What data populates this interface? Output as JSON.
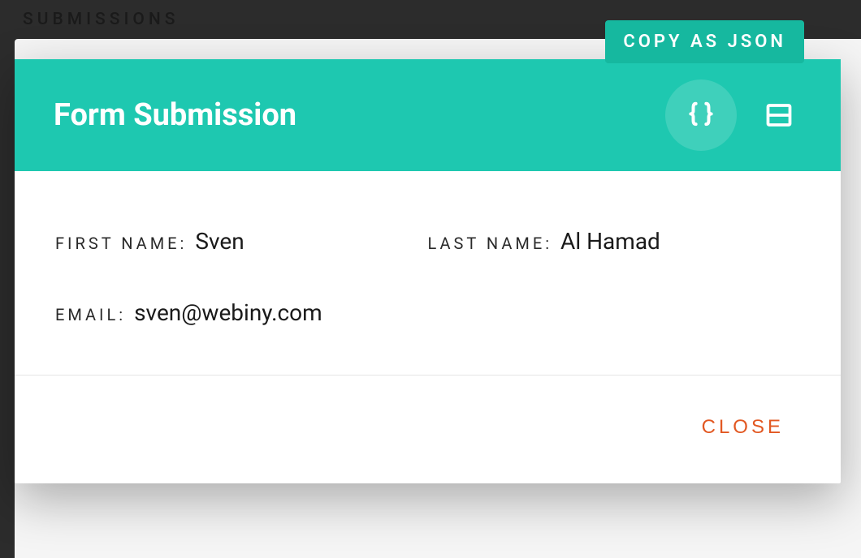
{
  "page": {
    "header": "SUBMISSIONS"
  },
  "dialog": {
    "title": "Form Submission",
    "tooltip": "COPY AS JSON",
    "fields": {
      "firstName": {
        "label": "FIRST NAME:",
        "value": "Sven"
      },
      "lastName": {
        "label": "LAST NAME:",
        "value": "Al Hamad"
      },
      "email": {
        "label": "EMAIL:",
        "value": "sven@webiny.com"
      }
    },
    "closeLabel": "CLOSE"
  },
  "colors": {
    "teal": "#1ec8b0",
    "tealDark": "#16b89f",
    "orange": "#e25822"
  }
}
